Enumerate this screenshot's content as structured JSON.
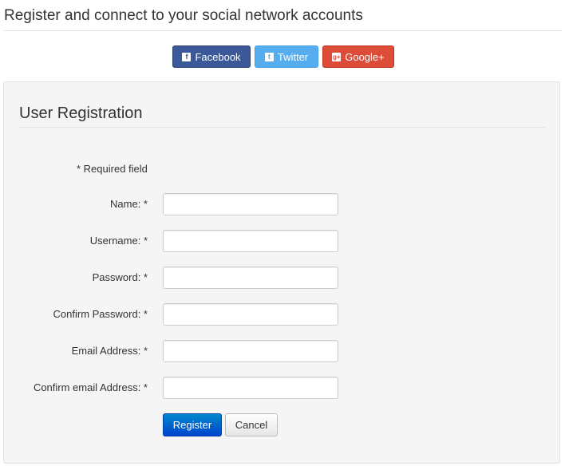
{
  "header": {
    "title": "Register and connect to your social network accounts"
  },
  "social": {
    "facebook": {
      "label": "Facebook",
      "icon": "facebook-icon",
      "color": "#3b5998"
    },
    "twitter": {
      "label": "Twitter",
      "icon": "twitter-icon",
      "color": "#55acee"
    },
    "google": {
      "label": "Google+",
      "icon": "google-plus-icon",
      "color": "#dd4b39"
    }
  },
  "form": {
    "title": "User Registration",
    "required_note": "* Required field",
    "fields": [
      {
        "label": "Name: *",
        "value": "",
        "placeholder": ""
      },
      {
        "label": "Username: *",
        "value": "",
        "placeholder": ""
      },
      {
        "label": "Password: *",
        "value": "",
        "placeholder": ""
      },
      {
        "label": "Confirm Password: *",
        "value": "",
        "placeholder": ""
      },
      {
        "label": "Email Address: *",
        "value": "",
        "placeholder": ""
      },
      {
        "label": "Confirm email Address: *",
        "value": "",
        "placeholder": ""
      }
    ],
    "register_label": "Register",
    "cancel_label": "Cancel"
  },
  "colors": {
    "primary": "#0055cc",
    "well_background": "#f5f5f5"
  }
}
